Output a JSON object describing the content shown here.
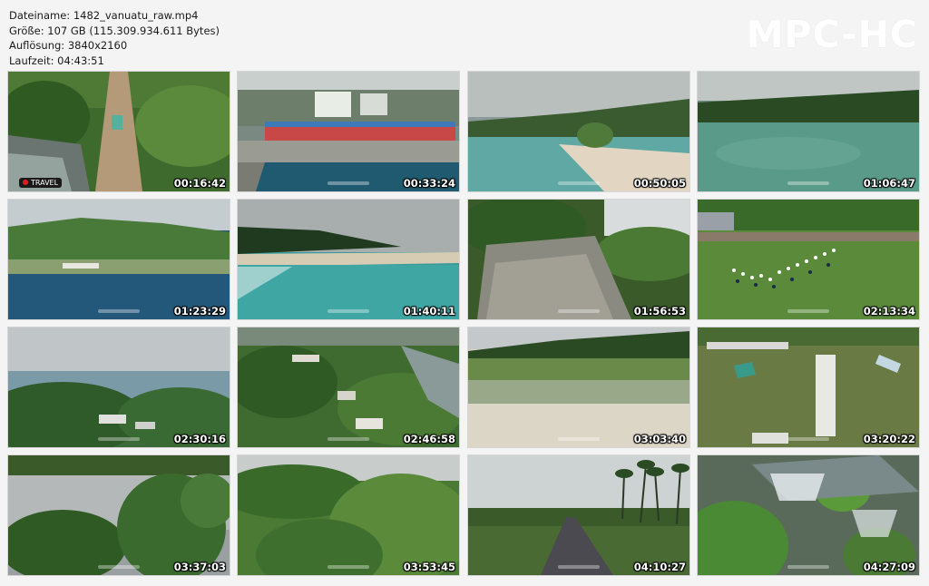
{
  "file_info": {
    "filename": "Dateiname: 1482_vanuatu_raw.mp4",
    "size": "Größe: 107 GB (115.309.934.611 Bytes)",
    "resolution": "Auflösung: 3840x2160",
    "duration": "Laufzeit: 04:43:51"
  },
  "logo": "MPC-HC",
  "thumbnails": [
    {
      "timestamp": "00:16:42",
      "scene": "dirt-road-bridge-forest",
      "rec_label": "TRAVEL"
    },
    {
      "timestamp": "00:33:24",
      "scene": "harbor-market-town"
    },
    {
      "timestamp": "00:50:05",
      "scene": "turquoise-beach-palms"
    },
    {
      "timestamp": "01:06:47",
      "scene": "jungle-lagoon"
    },
    {
      "timestamp": "01:23:29",
      "scene": "coastal-hills-village"
    },
    {
      "timestamp": "01:40:11",
      "scene": "beach-shoreline-bay"
    },
    {
      "timestamp": "01:56:53",
      "scene": "limestone-cliff-jungle"
    },
    {
      "timestamp": "02:13:34",
      "scene": "parade-field-crowd"
    },
    {
      "timestamp": "02:30:16",
      "scene": "coastal-village-trees"
    },
    {
      "timestamp": "02:46:58",
      "scene": "village-river-aerial"
    },
    {
      "timestamp": "03:03:40",
      "scene": "sandy-beach-hills"
    },
    {
      "timestamp": "03:20:22",
      "scene": "grass-field-tents"
    },
    {
      "timestamp": "03:37:03",
      "scene": "river-trees-mist"
    },
    {
      "timestamp": "03:53:45",
      "scene": "forest-canopy"
    },
    {
      "timestamp": "04:10:27",
      "scene": "road-palm-trees"
    },
    {
      "timestamp": "04:27:09",
      "scene": "waterfall-rocks"
    }
  ]
}
